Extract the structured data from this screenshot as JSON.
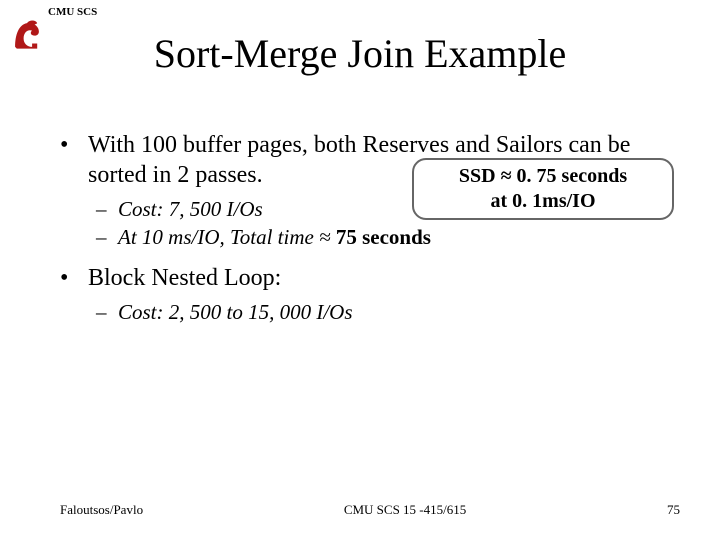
{
  "header": {
    "label": "CMU SCS"
  },
  "title": "Sort-Merge Join Example",
  "bullets": {
    "b1": {
      "dot": "•",
      "text": "With 100 buffer pages, both Reserves and Sailors can be sorted in 2 passes."
    },
    "s1": {
      "dash": "–",
      "prefix": "Cost: ",
      "value": "7, 500 I/Os"
    },
    "s2": {
      "dash": "–",
      "prefix": "At 10 ms/IO, Total time ≈ ",
      "value": "75 seconds"
    },
    "b2": {
      "dot": "•",
      "text": "Block Nested Loop:"
    },
    "s3": {
      "dash": "–",
      "prefix": "Cost: ",
      "value": "2, 500 to 15, 000 I/Os"
    }
  },
  "callout": {
    "line1": "SSD ≈ 0. 75 seconds",
    "line2": "at 0. 1ms/IO"
  },
  "footer": {
    "left": "Faloutsos/Pavlo",
    "center": "CMU SCS 15 -415/615",
    "right": "75"
  }
}
